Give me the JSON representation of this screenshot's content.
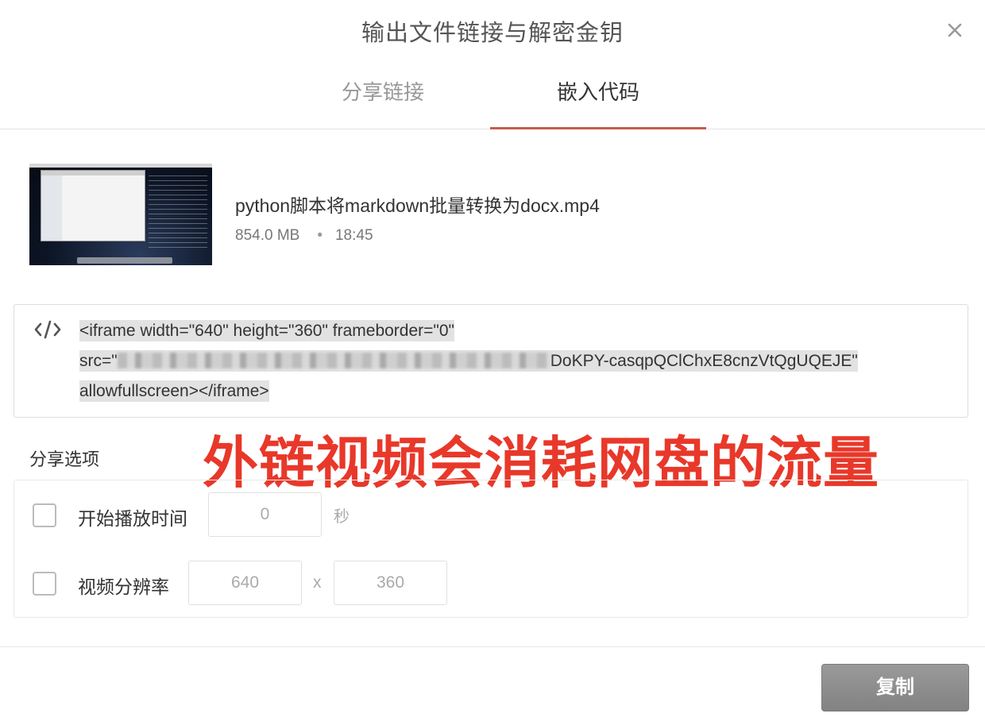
{
  "dialog": {
    "title": "输出文件链接与解密金钥"
  },
  "tabs": [
    {
      "label": "分享链接",
      "active": false
    },
    {
      "label": "嵌入代码",
      "active": true
    }
  ],
  "file": {
    "name": "python脚本将markdown批量转换为docx.mp4",
    "size": "854.0 MB",
    "separator": "•",
    "duration": "18:45"
  },
  "embed": {
    "line1": "<iframe width=\"640\" height=\"360\" frameborder=\"0\"",
    "line2_prefix": "src=\"",
    "line2_suffix": "DoKPY-casqpQClChxE8cnzVtQgUQEJE\"",
    "line3": "allowfullscreen></iframe>"
  },
  "options": {
    "title": "分享选项",
    "start_time": {
      "label": "开始播放时间",
      "value": "0",
      "unit": "秒"
    },
    "resolution": {
      "label": "视频分辨率",
      "width": "640",
      "separator": "x",
      "height": "360"
    }
  },
  "overlay_text": "外链视频会消耗网盘的流量",
  "footer": {
    "copy_label": "复制"
  },
  "colors": {
    "accent": "#c75b4d",
    "overlay": "#e8382a",
    "button": "#8c8c8c"
  }
}
